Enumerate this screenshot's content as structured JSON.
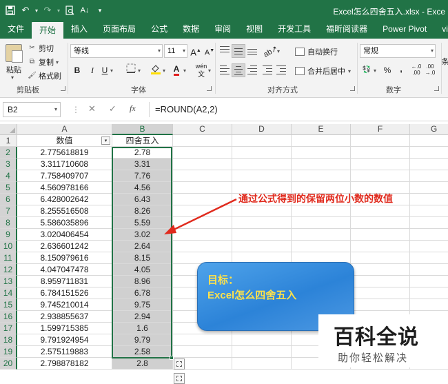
{
  "window": {
    "title": "Excel怎么四舍五入.xlsx - Exce"
  },
  "tabs": [
    "文件",
    "开始",
    "插入",
    "页面布局",
    "公式",
    "数据",
    "审阅",
    "视图",
    "开发工具",
    "福昕阅读器",
    "Power Pivot",
    "view"
  ],
  "active_tab": "开始",
  "ribbon": {
    "clipboard": {
      "paste": "粘贴",
      "cut": "剪切",
      "copy": "复制",
      "format_painter": "格式刷",
      "group": "剪贴板"
    },
    "font": {
      "name": "等线",
      "size": "11",
      "grow": "A",
      "shrink": "A",
      "bold": "B",
      "italic": "I",
      "underline": "U",
      "pinyin": "wén",
      "group": "字体"
    },
    "alignment": {
      "wrap": "自动换行",
      "merge": "合并后居中",
      "group": "对齐方式"
    },
    "number": {
      "format": "常规",
      "percent": "%",
      "comma": ",",
      "group": "数字"
    },
    "styles": {
      "cond": "条"
    }
  },
  "formula_bar": {
    "name_box": "B2",
    "fx": "fx",
    "formula": "=ROUND(A2,2)"
  },
  "grid": {
    "columns": [
      "A",
      "B",
      "C",
      "D",
      "E",
      "F",
      "G"
    ],
    "selected_column": "B",
    "selected_cell": "B2",
    "header_row": {
      "a": "数值",
      "b": "四舍五入"
    },
    "rows": [
      {
        "row": "1"
      },
      {
        "row": "2",
        "a": "2.775618819",
        "b": "2.78"
      },
      {
        "row": "3",
        "a": "3.311710608",
        "b": "3.31"
      },
      {
        "row": "4",
        "a": "7.758409707",
        "b": "7.76"
      },
      {
        "row": "5",
        "a": "4.560978166",
        "b": "4.56"
      },
      {
        "row": "6",
        "a": "6.428002642",
        "b": "6.43"
      },
      {
        "row": "7",
        "a": "8.255516508",
        "b": "8.26"
      },
      {
        "row": "8",
        "a": "5.586035896",
        "b": "5.59"
      },
      {
        "row": "9",
        "a": "3.020406454",
        "b": "3.02"
      },
      {
        "row": "10",
        "a": "2.636601242",
        "b": "2.64"
      },
      {
        "row": "11",
        "a": "8.150979616",
        "b": "8.15"
      },
      {
        "row": "12",
        "a": "4.047047478",
        "b": "4.05"
      },
      {
        "row": "13",
        "a": "8.959711831",
        "b": "8.96"
      },
      {
        "row": "14",
        "a": "6.784151526",
        "b": "6.78"
      },
      {
        "row": "15",
        "a": "9.745210014",
        "b": "9.75"
      },
      {
        "row": "16",
        "a": "2.938855637",
        "b": "2.94"
      },
      {
        "row": "17",
        "a": "1.599715385",
        "b": "1.6"
      },
      {
        "row": "18",
        "a": "9.791924954",
        "b": "9.79"
      },
      {
        "row": "19",
        "a": "2.575119883",
        "b": "2.58"
      },
      {
        "row": "20",
        "a": "2.798878182",
        "b": "2.8"
      }
    ]
  },
  "annotation": {
    "callout": "通过公式得到的保留两位小数的数值"
  },
  "info_box": {
    "line1": "目标：",
    "line2": "Excel怎么四舍五入"
  },
  "watermark": {
    "title": "百科全说",
    "subtitle": "助你轻松解决"
  },
  "colors": {
    "excel_green": "#217346",
    "callout_red": "#e02a1d",
    "box_blue": "#2c83d8",
    "box_text": "#ffe24a"
  }
}
